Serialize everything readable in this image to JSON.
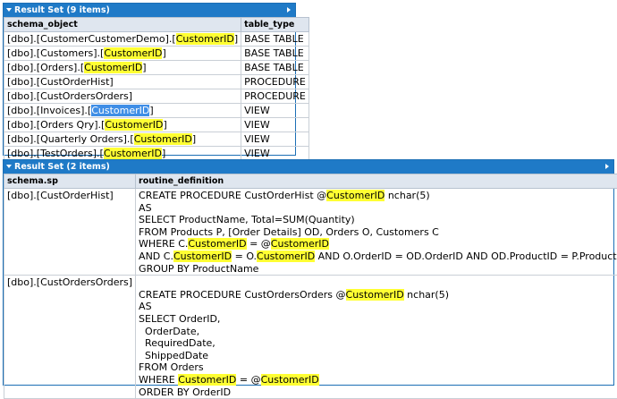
{
  "result1": {
    "title": "Result Set (9 items)",
    "columns": [
      "schema_object",
      "table_type"
    ],
    "rows": [
      [
        [
          "[dbo].[CustomerCustomerDemo].[",
          ""
        ],
        [
          "CustomerID",
          "hl"
        ],
        [
          "]",
          ""
        ],
        "BASE TABLE"
      ],
      [
        [
          "[dbo].[Customers].[",
          ""
        ],
        [
          "CustomerID",
          "hl"
        ],
        [
          "]",
          ""
        ],
        "BASE TABLE"
      ],
      [
        [
          "[dbo].[Orders].[",
          ""
        ],
        [
          "CustomerID",
          "hl"
        ],
        [
          "]",
          ""
        ],
        "BASE TABLE"
      ],
      [
        [
          "[dbo].[CustOrderHist]",
          ""
        ],
        "PROCEDURE"
      ],
      [
        [
          "[dbo].[CustOrdersOrders]",
          ""
        ],
        "PROCEDURE"
      ],
      [
        [
          "[dbo].[Invoices].[",
          ""
        ],
        [
          "CustomerID",
          "sel"
        ],
        [
          "]",
          ""
        ],
        "VIEW"
      ],
      [
        [
          "[dbo].[Orders Qry].[",
          ""
        ],
        [
          "CustomerID",
          "hl"
        ],
        [
          "]",
          ""
        ],
        "VIEW"
      ],
      [
        [
          "[dbo].[Quarterly Orders].[",
          ""
        ],
        [
          "CustomerID",
          "hl"
        ],
        [
          "]",
          ""
        ],
        "VIEW"
      ],
      [
        [
          "[dbo].[TestOrders].[",
          ""
        ],
        [
          "CustomerID",
          "hl"
        ],
        [
          "]",
          ""
        ],
        "VIEW"
      ]
    ]
  },
  "result2": {
    "title": "Result Set (2 items)",
    "columns": [
      "schema.sp",
      "routine_definition"
    ],
    "rows": [
      {
        "sp": "[dbo].[CustOrderHist]",
        "lines": [
          [
            [
              "CREATE PROCEDURE CustOrderHist @",
              ""
            ],
            [
              "CustomerID",
              "hl"
            ],
            [
              " nchar(5)",
              ""
            ]
          ],
          [
            [
              "AS",
              ""
            ]
          ],
          [
            [
              "SELECT ProductName, Total=SUM(Quantity)",
              ""
            ]
          ],
          [
            [
              "FROM Products P, [Order Details] OD, Orders O, Customers C",
              ""
            ]
          ],
          [
            [
              "WHERE C.",
              ""
            ],
            [
              "CustomerID",
              "hl"
            ],
            [
              " = @",
              ""
            ],
            [
              "CustomerID",
              "hl"
            ]
          ],
          [
            [
              "AND C.",
              ""
            ],
            [
              "CustomerID",
              "hl"
            ],
            [
              " = O.",
              ""
            ],
            [
              "CustomerID",
              "hl"
            ],
            [
              " AND O.OrderID = OD.OrderID AND OD.ProductID = P.ProductID",
              ""
            ]
          ],
          [
            [
              "GROUP BY ProductName",
              ""
            ]
          ]
        ]
      },
      {
        "sp": "[dbo].[CustOrdersOrders]",
        "lines": [
          [
            [
              "",
              ""
            ]
          ],
          [
            [
              "CREATE PROCEDURE CustOrdersOrders @",
              ""
            ],
            [
              "CustomerID",
              "hl"
            ],
            [
              " nchar(5)",
              ""
            ]
          ],
          [
            [
              "AS",
              ""
            ]
          ],
          [
            [
              "SELECT OrderID,",
              ""
            ]
          ],
          [
            [
              "  OrderDate,",
              ""
            ]
          ],
          [
            [
              "  RequiredDate,",
              ""
            ]
          ],
          [
            [
              "  ShippedDate",
              ""
            ]
          ],
          [
            [
              "FROM Orders",
              ""
            ]
          ],
          [
            [
              "WHERE ",
              ""
            ],
            [
              "CustomerID",
              "hl"
            ],
            [
              " = @",
              ""
            ],
            [
              "CustomerID",
              "hl"
            ]
          ],
          [
            [
              "ORDER BY OrderID",
              ""
            ]
          ]
        ]
      }
    ]
  }
}
